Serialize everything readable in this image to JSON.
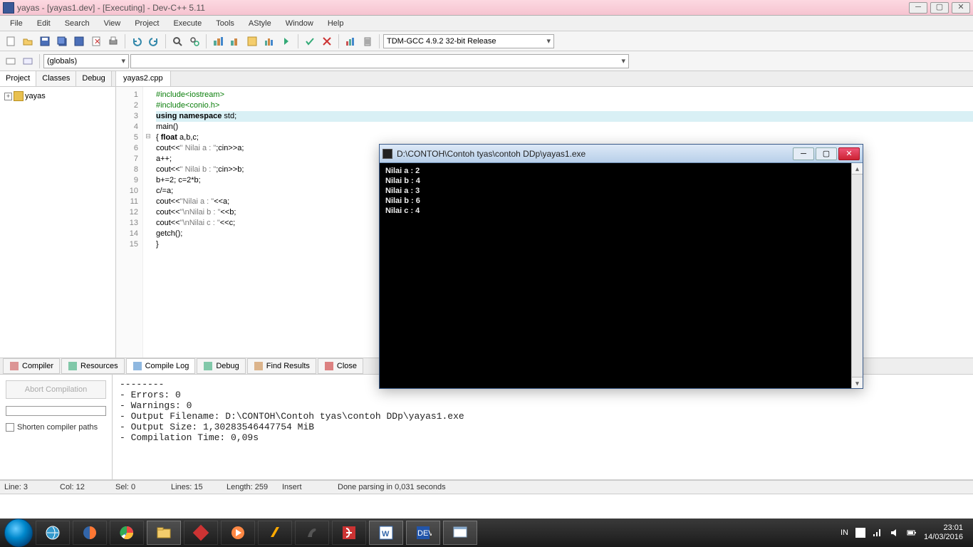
{
  "window": {
    "title": "yayas - [yayas1.dev] - [Executing] - Dev-C++ 5.11"
  },
  "menu": [
    "File",
    "Edit",
    "Search",
    "View",
    "Project",
    "Execute",
    "Tools",
    "AStyle",
    "Window",
    "Help"
  ],
  "toolbar2": {
    "compiler_selector": "TDM-GCC 4.9.2 32-bit Release"
  },
  "scope_combo": "(globals)",
  "left_tabs": [
    "Project",
    "Classes",
    "Debug"
  ],
  "project_tree": {
    "root": "yayas"
  },
  "file_tab": "yayas2.cpp",
  "code_lines": [
    {
      "n": 1,
      "html": "<span class='pp'>#include&lt;iostream&gt;</span>"
    },
    {
      "n": 2,
      "html": "<span class='pp'>#include&lt;conio.h&gt;</span>"
    },
    {
      "n": 3,
      "html": "<span class='kw'>using</span> <span class='kw'>namespace</span> std;",
      "hl": true
    },
    {
      "n": 4,
      "html": "main()"
    },
    {
      "n": 5,
      "html": "{ <span class='kw'>float</span> a,b,c;",
      "fold": true
    },
    {
      "n": 6,
      "html": "cout&lt;&lt;<span class='str'>\" Nilai a : \"</span>;cin&gt;&gt;a;"
    },
    {
      "n": 7,
      "html": "a++;"
    },
    {
      "n": 8,
      "html": "cout&lt;&lt;<span class='str'>\" Nilai b : \"</span>;cin&gt;&gt;b;"
    },
    {
      "n": 9,
      "html": "b+=2; c=2*b;"
    },
    {
      "n": 10,
      "html": "c/=a;"
    },
    {
      "n": 11,
      "html": "cout&lt;&lt;<span class='str'>\"Nilai a : \"</span>&lt;&lt;a;"
    },
    {
      "n": 12,
      "html": "cout&lt;&lt;<span class='str'>\"\\nNilai b : \"</span>&lt;&lt;b;"
    },
    {
      "n": 13,
      "html": "cout&lt;&lt;<span class='str'>\"\\nNilai c : \"</span>&lt;&lt;c;"
    },
    {
      "n": 14,
      "html": "getch();"
    },
    {
      "n": 15,
      "html": "}"
    }
  ],
  "console": {
    "title": "D:\\CONTOH\\Contoh tyas\\contoh DDp\\yayas1.exe",
    "lines": [
      " Nilai a : 2",
      " Nilai b : 4",
      "Nilai a : 3",
      "Nilai b : 6",
      "Nilai c : 4"
    ]
  },
  "bottom_tabs": [
    "Compiler",
    "Resources",
    "Compile Log",
    "Debug",
    "Find Results",
    "Close"
  ],
  "log_side": {
    "abort": "Abort Compilation",
    "shorten": "Shorten compiler paths"
  },
  "compile_log": "--------\n- Errors: 0\n- Warnings: 0\n- Output Filename: D:\\CONTOH\\Contoh tyas\\contoh DDp\\yayas1.exe\n- Output Size: 1,30283546447754 MiB\n- Compilation Time: 0,09s",
  "status": {
    "line": "Line:   3",
    "col": "Col:   12",
    "sel": "Sel:   0",
    "lines": "Lines:   15",
    "length": "Length:   259",
    "mode": "Insert",
    "msg": "Done parsing in 0,031 seconds"
  },
  "tray": {
    "lang": "IN",
    "time": "23:01",
    "date": "14/03/2016"
  }
}
